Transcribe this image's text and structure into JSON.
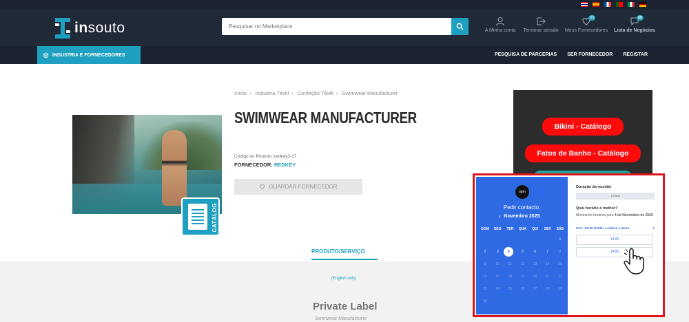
{
  "flags": [
    "en-flag",
    "es-flag",
    "fr-flag",
    "pt-flag",
    "it-flag",
    "de-flag"
  ],
  "brand": {
    "prefix": "in",
    "suffix": "souto"
  },
  "search": {
    "placeholder": "Pesquisar no Marketplace"
  },
  "header_nav": [
    {
      "label": "A Minha conta",
      "icon": "user-icon"
    },
    {
      "label": "Terminar sessão",
      "icon": "logout-icon"
    },
    {
      "label": "Meus Fornecedores",
      "icon": "heart-icon",
      "badge": "(0)"
    },
    {
      "label": "Lista de Negócios",
      "icon": "chat-icon",
      "badge": "(0)"
    }
  ],
  "navbar": {
    "category_button": "INDUSTRIA E FORNECEDORES",
    "links": [
      "PESQUISA DE PARCERIAS",
      "SER FORNECEDOR",
      "REGISTAR"
    ]
  },
  "breadcrumb": [
    "Início",
    "Indústria Têxtil",
    "Confeção Têxtil",
    "Swimwear Manufacturer"
  ],
  "product": {
    "title": "SWIMWEAR MANUFACTURER",
    "code_label": "Código do Produto:",
    "code": "redkey3-17",
    "supplier_label": "FORNECEDOR:",
    "supplier": "REDKEY",
    "save_button": "GUARDAR FORNECEDOR",
    "catalog_badge": "CATÁLOG"
  },
  "side_buttons": [
    "Bikini - Catálogo",
    "Fatos de Banho - Catálogo"
  ],
  "tabs": {
    "active": "PRODUTO/SERVIÇO"
  },
  "content": {
    "note": "(English only)",
    "heading": "Private Label",
    "subheading": "Swimwear Manufacturer"
  },
  "booking": {
    "logo_text": "opm",
    "title": "Pedir contacto.",
    "month": "Novembro 2025",
    "weekdays": [
      "DOM",
      "SEG",
      "TER",
      "QUA",
      "QUI",
      "SEX",
      "SÁB"
    ],
    "weeks": [
      [
        "",
        "",
        "",
        "",
        "",
        "",
        "1"
      ],
      [
        "2",
        "3",
        "4",
        "5",
        "6",
        "7",
        "8"
      ],
      [
        "9",
        "10",
        "11",
        "12",
        "13",
        "14",
        "15"
      ],
      [
        "16",
        "17",
        "18",
        "19",
        "20",
        "21",
        "22"
      ],
      [
        "23",
        "24",
        "25",
        "26",
        "27",
        "28",
        "29"
      ],
      [
        "30",
        "",
        "",
        "",
        "",
        "",
        ""
      ]
    ],
    "selected_day": "4",
    "duration_label": "Duração da reunião",
    "duration_value": "1 hora",
    "question": "Qual horário é melhor?",
    "showing_prefix": "Mostrando horários para",
    "showing_date": "4 de Novembro de 2025",
    "timezone": "UTC +00:00 Dublin, Londres, Lisboa",
    "slots": [
      "13:00",
      "14:00"
    ]
  }
}
